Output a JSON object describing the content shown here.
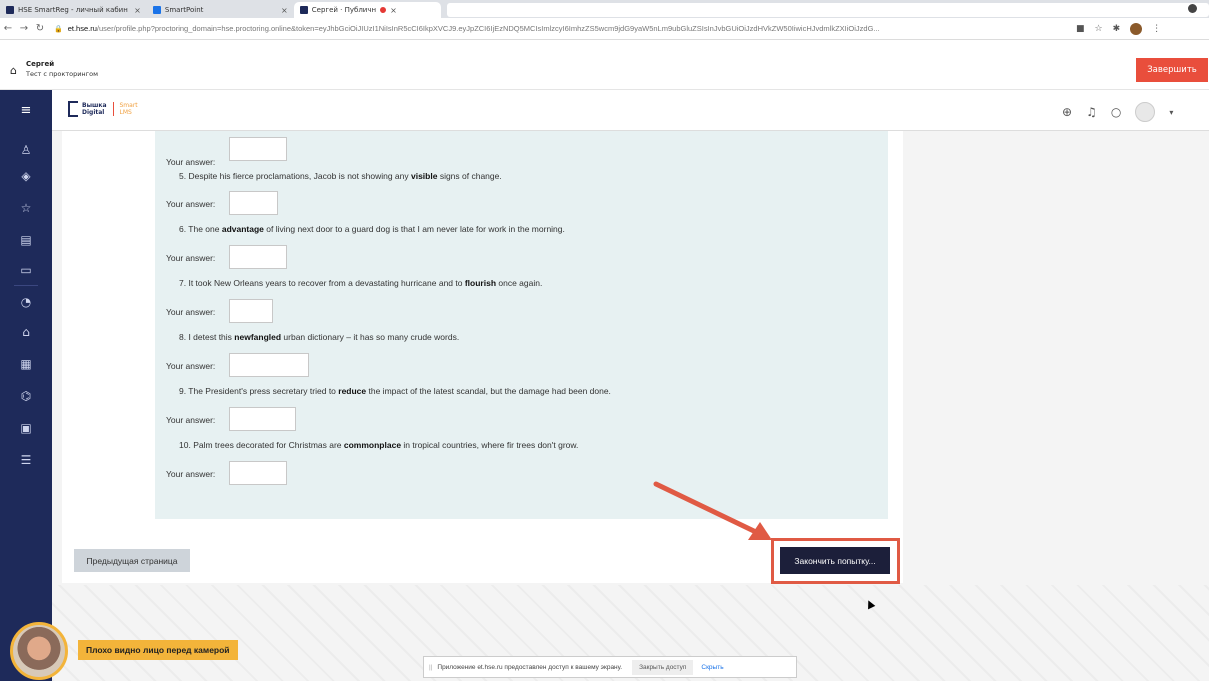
{
  "browser": {
    "tabs": [
      {
        "title": "HSE SmartReg - личный кабин",
        "icon": "hse-icon"
      },
      {
        "title": "SmartPoint",
        "icon": "smartpoint-icon"
      },
      {
        "title": "Сергей · Публичн",
        "icon": "hse-icon"
      }
    ],
    "url_host": "et.hse.ru",
    "url_rest": "/user/profile.php?proctoring_domain=hse.proctoring.online&token=eyJhbGciOiJIUzI1NiIsInR5cCI6IkpXVCJ9.eyJpZCI6IjEzNDQ5MCIsImlzcyI6ImhzZS5wcm9jdG9yaW5nLm9ubGluZSIsInJvbGUiOiJzdHVkZW50IiwicHJvdmlkZXIiOiJzdG..."
  },
  "proctoring": {
    "user_name": "Сергей",
    "subtitle": "Тест с прокторингом",
    "finish_label": "Завершить"
  },
  "lms": {
    "logo_line1": "Вышка",
    "logo_line2": "Digital",
    "logo_smart1": "Smart",
    "logo_smart2": "LMS"
  },
  "questions": [
    {
      "num": "5.",
      "pre": " Despite his fierce proclamations, Jacob is not showing any ",
      "bold": "visible",
      "post": " signs of change."
    },
    {
      "num": "6.",
      "pre": " The one ",
      "bold": "advantage",
      "post": " of living next door to a guard dog is that I am never late for work in the morning."
    },
    {
      "num": "7.",
      "pre": " It took New Orleans years to recover from a devastating hurricane and to ",
      "bold": "flourish",
      "post": " once again."
    },
    {
      "num": "8.",
      "pre": " I detest this ",
      "bold": "newfangled",
      "post": " urban dictionary – it has so many crude words."
    },
    {
      "num": "9.",
      "pre": " The President's press secretary tried to ",
      "bold": "reduce",
      "post": " the impact of the latest scandal, but the damage had been done."
    },
    {
      "num": "10.",
      "pre": " Palm trees decorated for Christmas are ",
      "bold": "commonplace",
      "post": " in tropical countries, where fir trees don't grow."
    }
  ],
  "answer_label": "Your answer:",
  "buttons": {
    "prev_page": "Предыдущая страница",
    "finish_attempt": "Закончить попытку..."
  },
  "webcam": {
    "warning": "Плохо видно лицо перед камерой"
  },
  "sharebar": {
    "grip": "||",
    "message": "Приложение et.hse.ru предоставлен доступ к вашему экрану.",
    "stop": "Закрыть доступ",
    "hide": "Скрыть"
  }
}
